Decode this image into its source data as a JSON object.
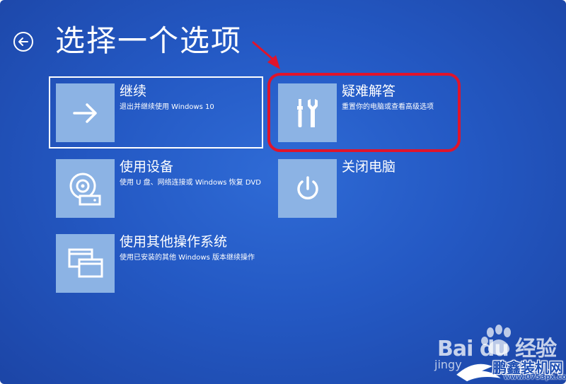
{
  "screen": {
    "title": "选择一个选项"
  },
  "options": {
    "continue": {
      "title": "继续",
      "desc": "退出并继续使用 Windows 10"
    },
    "use_device": {
      "title": "使用设备",
      "desc": "使用 U 盘、网络连接或 Windows 恢复 DVD"
    },
    "other_os": {
      "title": "使用其他操作系统",
      "desc": "使用已安装的其他 Windows 版本继续操作"
    },
    "troubleshoot": {
      "title": "疑难解答",
      "desc": "重置你的电脑或查看高级选项"
    },
    "shutdown": {
      "title": "关闭电脑"
    }
  },
  "watermarks": {
    "baidu_logo": "Bai du 经验",
    "baidu_sub": "jingy",
    "site_name": "鹏鑫装机网",
    "site_url": "www.0753px.com"
  },
  "colors": {
    "background": "#2459c4",
    "tile": "#8cb3e4",
    "highlight": "#e0142b",
    "text": "#ffffff"
  },
  "icons": {
    "back": "back-arrow-circle-icon",
    "continue": "arrow-right-icon",
    "use_device": "disc-drive-icon",
    "other_os": "windows-stack-icon",
    "troubleshoot": "tools-icon",
    "shutdown": "power-icon"
  }
}
